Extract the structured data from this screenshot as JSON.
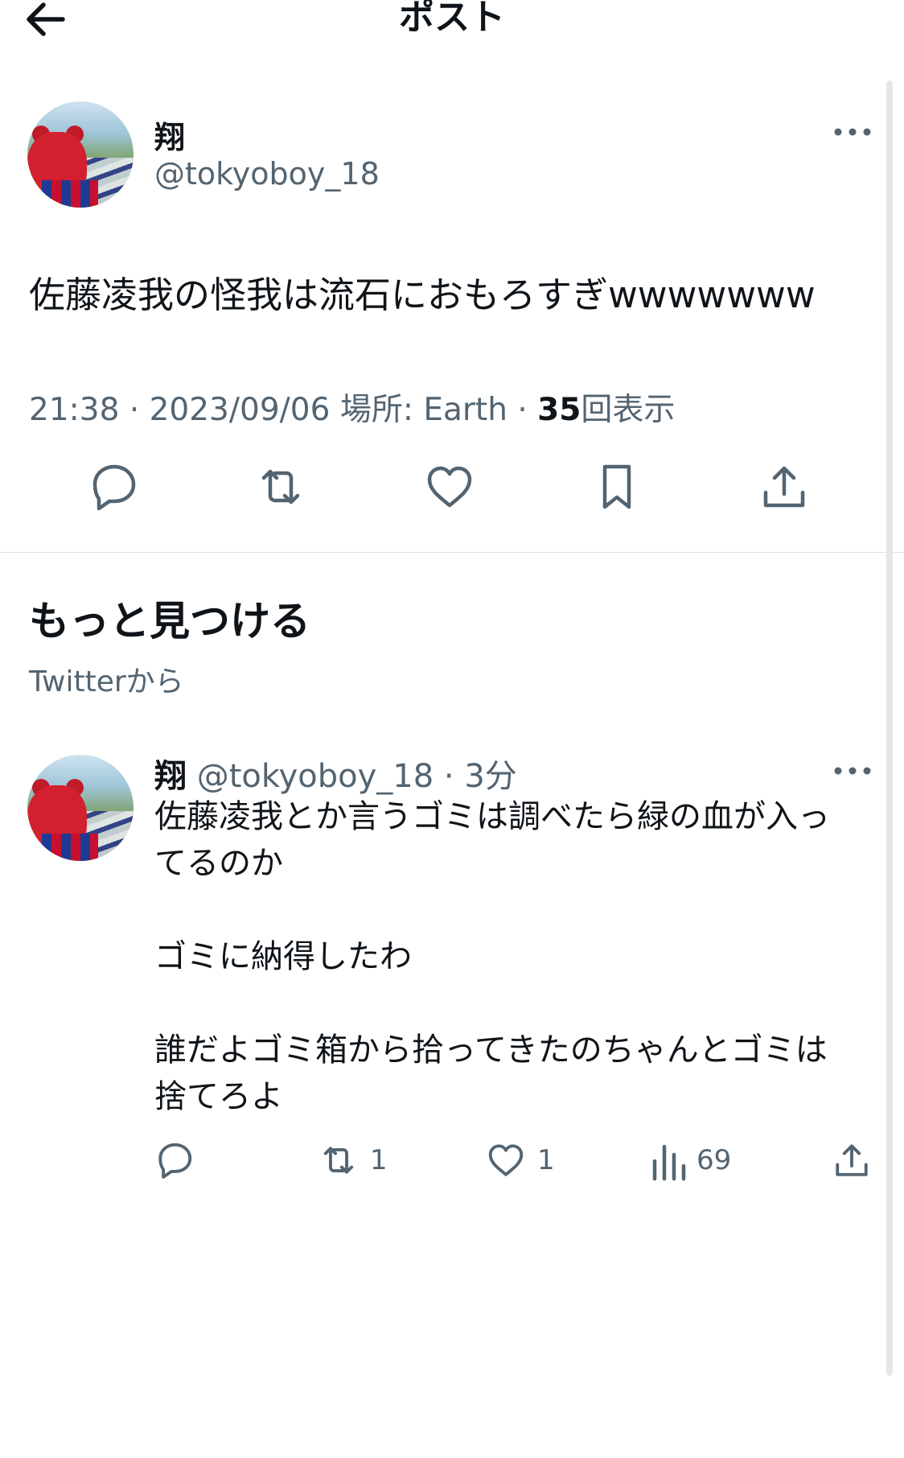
{
  "header": {
    "title": "ポスト"
  },
  "post": {
    "author_name": "翔",
    "author_handle": "@tokyoboy_18",
    "text": "佐藤凌我の怪我は流石におもろすぎwwwwwww",
    "time": "21:38",
    "date": "2023/09/06",
    "location_label": "場所: Earth",
    "views_count": "35",
    "views_label": "回表示"
  },
  "discover": {
    "title": "もっと見つける",
    "subtitle": "Twitterから"
  },
  "reply": {
    "author_name": "翔",
    "author_handle": "@tokyoboy_18",
    "time_ago": "3分",
    "lines": [
      "佐藤凌我とか言うゴミは調べたら緑の血が入っ",
      "てるのか",
      "ゴミに納得したわ",
      "誰だよゴミ箱から拾ってきたのちゃんとゴミは",
      "捨てろよ"
    ],
    "retweets": "1",
    "likes": "1",
    "views": "69"
  },
  "icons": {
    "back": "arrow-left-icon",
    "more": "more-horizontal-icon",
    "reply": "chat-bubble-icon",
    "retweet": "retweet-icon",
    "like": "heart-icon",
    "bookmark": "bookmark-icon",
    "share": "share-icon",
    "views": "bar-chart-icon"
  },
  "colors": {
    "text_primary": "#0f1419",
    "text_secondary": "#536471",
    "divider": "#dfe3e6"
  }
}
